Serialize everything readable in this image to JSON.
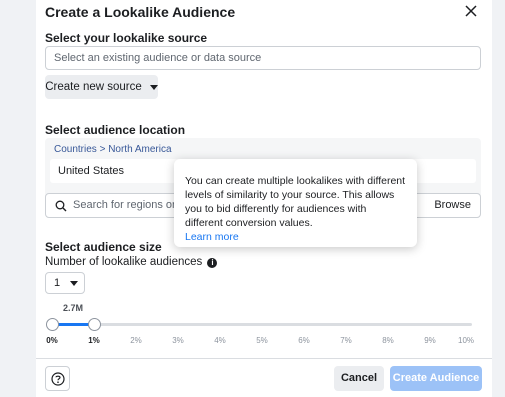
{
  "dialog": {
    "title": "Create a Lookalike Audience",
    "close_icon": "close-icon"
  },
  "source": {
    "label": "Select your lookalike source",
    "placeholder": "Select an existing audience or data source",
    "create_new_label": "Create new source"
  },
  "location": {
    "label": "Select audience location",
    "breadcrumb": "Countries > North America",
    "selected": "United States",
    "search_placeholder": "Search for regions or countries",
    "browse_label": "Browse"
  },
  "size": {
    "label": "Select audience size",
    "count_label": "Number of lookalike audiences",
    "count_value": "1",
    "reach": "2.7M",
    "range_min_percent": 0,
    "range_max_percent": 1,
    "ticks": [
      "0%",
      "1%",
      "2%",
      "3%",
      "4%",
      "5%",
      "6%",
      "7%",
      "8%",
      "9%",
      "10%"
    ]
  },
  "tooltip": {
    "text": "You can create multiple lookalikes with different levels of similarity to your source. This allows you to bid differently for audiences with different conversion values.",
    "link": "Learn more"
  },
  "footer": {
    "cancel_label": "Cancel",
    "create_label": "Create Audience"
  },
  "colors": {
    "accent": "#1877f2",
    "disabled_button": "#9cc2f7",
    "link": "#385898"
  }
}
